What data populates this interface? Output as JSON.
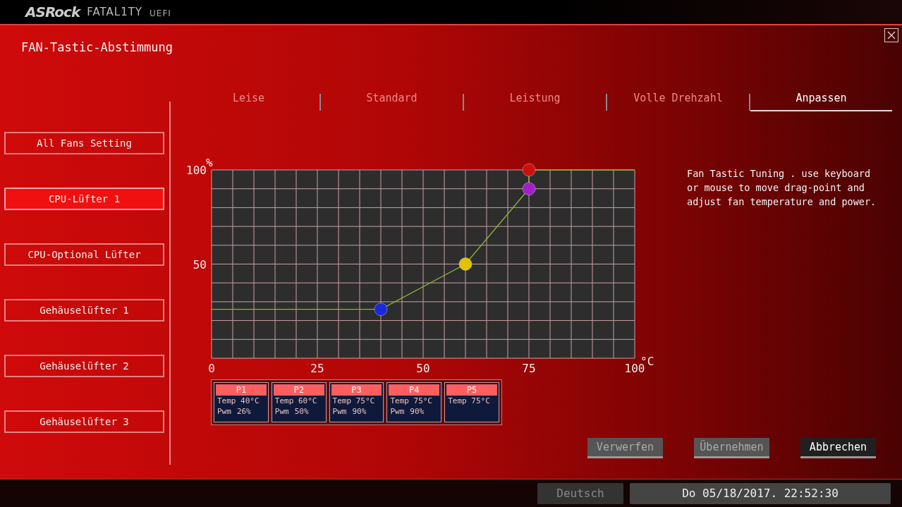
{
  "header": {
    "brand": "ASRock",
    "product": "FATAL1TY",
    "suffix": "UEFI"
  },
  "window": {
    "title": "FAN-Tastic-Abstimmung"
  },
  "tabs": [
    {
      "label": "Leise",
      "selected": false
    },
    {
      "label": "Standard",
      "selected": false
    },
    {
      "label": "Leistung",
      "selected": false
    },
    {
      "label": "Volle Drehzahl",
      "selected": false
    },
    {
      "label": "Anpassen",
      "selected": true
    }
  ],
  "sidebar": {
    "items": [
      {
        "label": "All Fans Setting",
        "selected": false
      },
      {
        "label": "CPU-Lüfter 1",
        "selected": true
      },
      {
        "label": "CPU-Optional Lüfter",
        "selected": false
      },
      {
        "label": "Gehäuselüfter 1",
        "selected": false
      },
      {
        "label": "Gehäuselüfter 2",
        "selected": false
      },
      {
        "label": "Gehäuselüfter 3",
        "selected": false
      }
    ]
  },
  "fan_curve": {
    "chart_data": {
      "type": "line",
      "xlabel": "°C",
      "ylabel": "%",
      "x": [
        0,
        40,
        60,
        75,
        75,
        100
      ],
      "xlim": [
        0,
        100
      ],
      "ylim": [
        0,
        100
      ],
      "xticks": [
        0,
        25,
        50,
        75,
        100
      ],
      "yticks": [
        50,
        100
      ],
      "grid": true,
      "series": [
        {
          "color": "#8db33a",
          "values": [
            26,
            26,
            50,
            90,
            100,
            100
          ]
        }
      ]
    }
  },
  "drag_points": [
    {
      "color": "#1a2ad8"
    },
    {
      "color": "#e2c200"
    },
    {
      "color": "#a21fc8"
    },
    {
      "color": "#cc1010"
    }
  ],
  "description": "Fan Tastic Tuning . use keyboard or mouse to move drag-point and adjust fan temperature and power.",
  "points": [
    {
      "label": "P1",
      "temp": "Temp 40°C",
      "pwm_label": "Pwm",
      "pwm": "26%"
    },
    {
      "label": "P2",
      "temp": "Temp 60°C",
      "pwm_label": "Pwm",
      "pwm": "50%"
    },
    {
      "label": "P3",
      "temp": "Temp 75°C",
      "pwm_label": "Pwm",
      "pwm": "90%"
    },
    {
      "label": "P4",
      "temp": "Temp 75°C",
      "pwm_label": "Pwm",
      "pwm": "90%"
    },
    {
      "label": "P5",
      "temp": "Temp 75°C"
    }
  ],
  "buttons": [
    {
      "label": "Verwerfen",
      "disabled": true
    },
    {
      "label": "Übernehmen",
      "disabled": true
    },
    {
      "label": "Abbrechen",
      "disabled": false
    }
  ],
  "status_bar": {
    "language": "Deutsch",
    "datetime": "Do 05/18/2017. 22:52:30"
  }
}
